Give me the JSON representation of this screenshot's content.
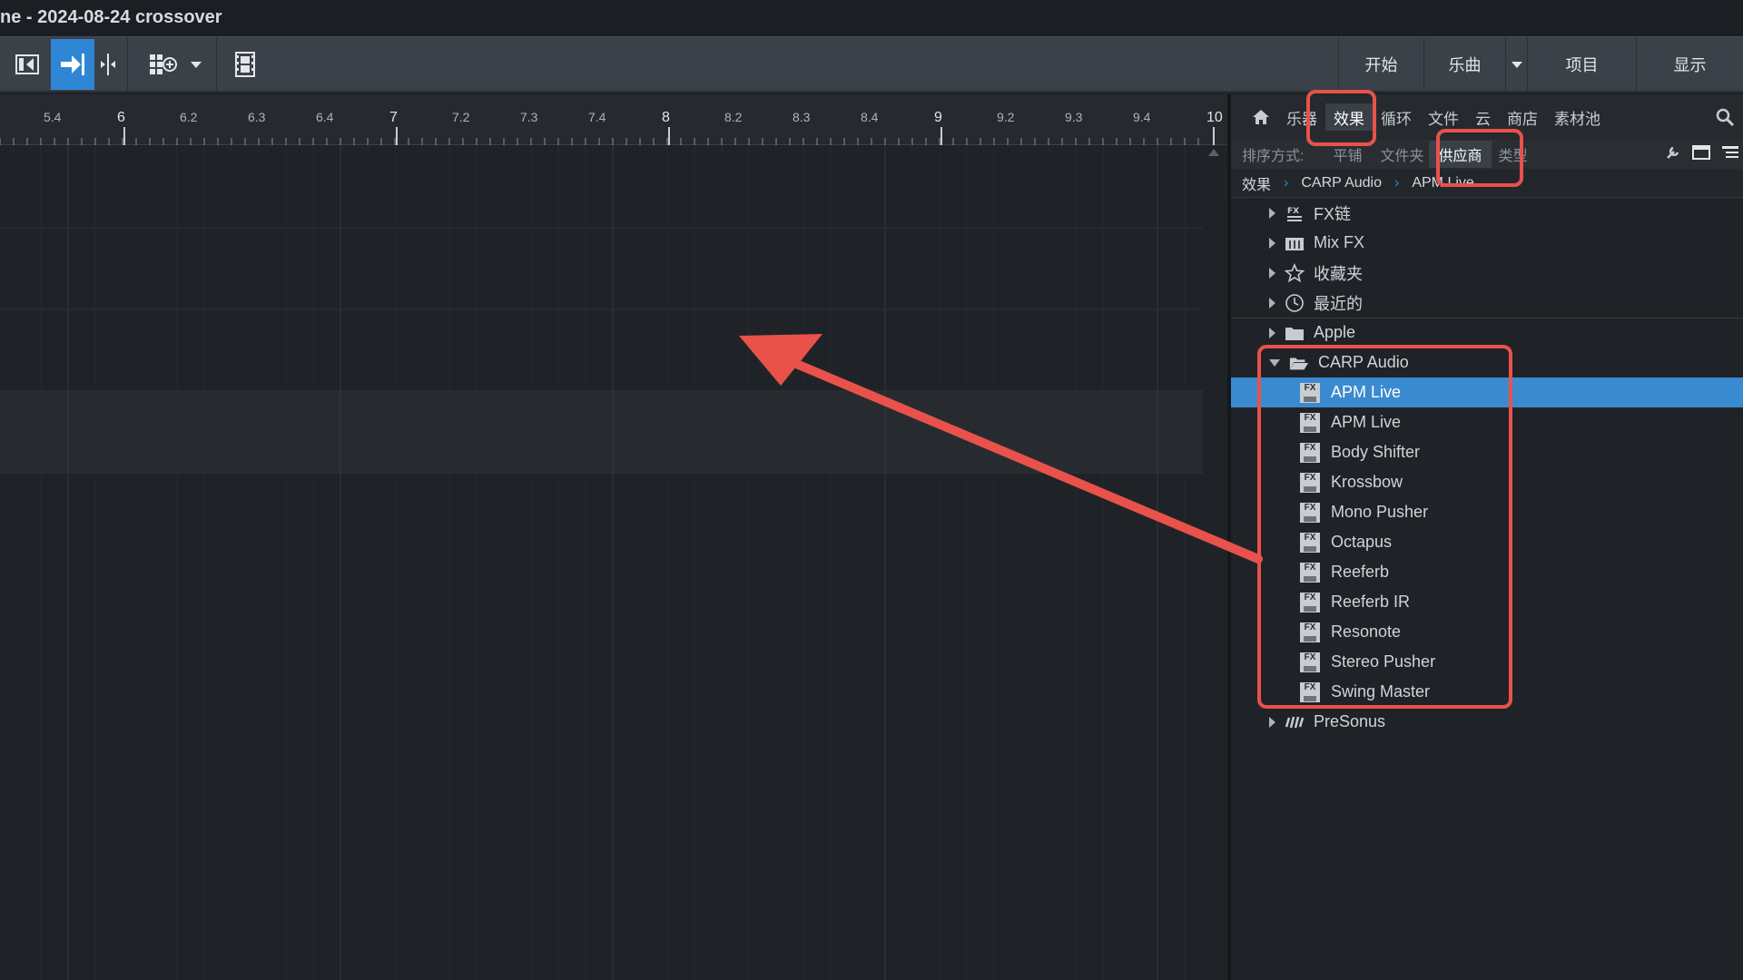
{
  "window": {
    "title": "ne - 2024-08-24 crossover"
  },
  "toolbar": {
    "left_icons": [
      "snap-to-start-icon",
      "arrow-right-icon",
      "split-icon",
      "grid-add-icon",
      "dropdown-icon",
      "film-icon"
    ],
    "right_buttons": [
      {
        "label": "开始"
      },
      {
        "label": "乐曲"
      },
      {
        "label": "项目"
      },
      {
        "label": "显示"
      }
    ]
  },
  "ruler": {
    "labels": [
      "5.4",
      "6",
      "6.2",
      "6.3",
      "6.4",
      "7",
      "7.2",
      "7.3",
      "7.4",
      "8",
      "8.2",
      "8.3",
      "8.4",
      "9",
      "9.2",
      "9.3",
      "9.4",
      "10"
    ]
  },
  "browser": {
    "tabs": [
      "乐器",
      "效果",
      "循环",
      "文件",
      "云",
      "商店",
      "素材池"
    ],
    "active_tab": "效果",
    "sort": {
      "label": "排序方式:",
      "options": [
        "平铺",
        "文件夹",
        "供应商",
        "类型"
      ],
      "active": "供应商"
    },
    "breadcrumb": [
      "效果",
      "CARP Audio",
      "APM Live"
    ],
    "tree": {
      "top_items": [
        {
          "label": "FX链",
          "icon": "fx-chain-icon"
        },
        {
          "label": "Mix FX",
          "icon": "mix-fx-icon"
        },
        {
          "label": "收藏夹",
          "icon": "star-icon"
        },
        {
          "label": "最近的",
          "icon": "clock-icon"
        }
      ],
      "apple": {
        "label": "Apple",
        "icon": "folder-icon"
      },
      "carp": {
        "label": "CARP Audio",
        "icon": "folder-open-icon",
        "plugins": [
          "APM Live",
          "APM Live",
          "Body Shifter",
          "Krossbow",
          "Mono Pusher",
          "Octapus",
          "Reeferb",
          "Reeferb IR",
          "Resonote",
          "Stereo Pusher",
          "Swing Master"
        ],
        "selected_index": 0
      },
      "presonus": {
        "label": "PreSonus",
        "icon": "presonus-icon"
      }
    }
  },
  "colors": {
    "accent": "#2e86d4",
    "selection": "#3a8ad0",
    "annotation": "#e8524a"
  }
}
